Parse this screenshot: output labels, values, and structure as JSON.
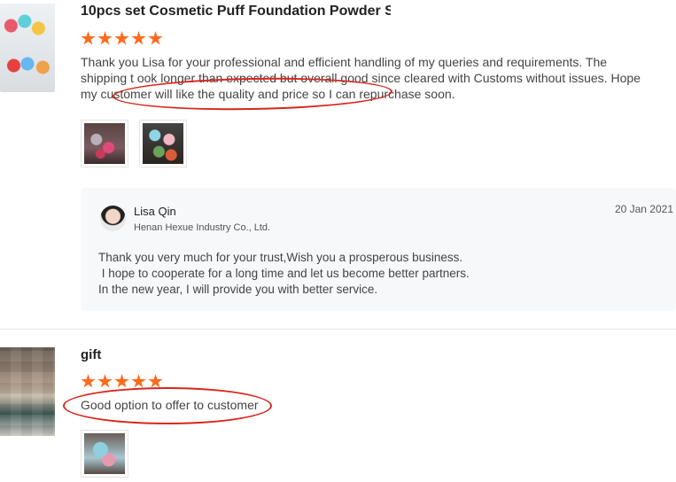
{
  "review1": {
    "title": "10pcs set Cosmetic Puff Foundation Powder S...",
    "rating": 5,
    "text": "Thank you Lisa for your professional and efficient handling of my queries and requirements. The shipping t ook longer than expected but overall good since cleared with Customs without issues. Hope my customer will like the quality and price so I can repurchase soon.",
    "reply": {
      "seller_name": "Lisa Qin",
      "company": "Henan Hexue Industry Co., Ltd.",
      "date": "20 Jan 2021",
      "lines": [
        "Thank you very much for your trust,Wish you a prosperous business.",
        " I hope to cooperate for a long time and let us become better partners.",
        "In the new year, I will provide you with better service."
      ]
    }
  },
  "review2": {
    "name": "gift",
    "rating": 5,
    "text": "Good option to offer to customer"
  },
  "colors": {
    "star": "#ff6a1b",
    "annotation": "#d9261c",
    "reply_bg": "#f7f8fa"
  }
}
